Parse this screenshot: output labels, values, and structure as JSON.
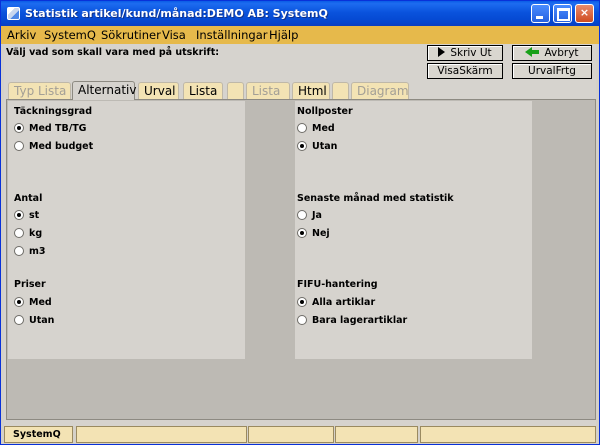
{
  "window": {
    "title": "Statistik artikel/kund/månad:DEMO AB: SystemQ",
    "minimize_label": "_",
    "maximize_label": "□",
    "close_label": "×"
  },
  "menu": {
    "items": [
      "Arkiv",
      "SystemQ",
      "Sökrutiner",
      "Visa",
      "Inställningar",
      "Hjälp"
    ]
  },
  "header": {
    "instruction": "Välj vad som skall vara med på utskrift:"
  },
  "buttons": {
    "print": "Skriv Ut",
    "cancel": "Avbryt",
    "show_screen": "VisaSkärm",
    "selection_question": "UrvalFrtg"
  },
  "tabs": [
    {
      "label": "Typ Lista",
      "state": "disabled"
    },
    {
      "label": "Alternativ",
      "state": "active"
    },
    {
      "label": "Urval",
      "state": "normal"
    },
    {
      "label": "Lista",
      "state": "normal"
    },
    {
      "label": "",
      "state": "disabled"
    },
    {
      "label": "Lista",
      "state": "disabled"
    },
    {
      "label": "Html",
      "state": "normal"
    },
    {
      "label": "",
      "state": "disabled"
    },
    {
      "label": "Diagram",
      "state": "disabled"
    }
  ],
  "groups": {
    "tackningsgrad": {
      "title": "Täckningsgrad",
      "options": [
        "Med TB/TG",
        "Med budget"
      ],
      "selected": 0
    },
    "antal": {
      "title": "Antal",
      "options": [
        "st",
        "kg",
        "m3"
      ],
      "selected": 0
    },
    "priser": {
      "title": "Priser",
      "options": [
        "Med",
        "Utan"
      ],
      "selected": 0
    },
    "nollposter": {
      "title": "Nollposter",
      "options": [
        "Med",
        "Utan"
      ],
      "selected": 1
    },
    "senaste_manad": {
      "title": "Senaste månad med statistik",
      "options": [
        "Ja",
        "Nej"
      ],
      "selected": 1
    },
    "fifu": {
      "title": "FIFU-hantering",
      "options": [
        "Alla artiklar",
        "Bara lagerartiklar"
      ],
      "selected": 0
    }
  },
  "statusbar": {
    "cells": [
      "SystemQ",
      "",
      "",
      "",
      ""
    ]
  },
  "colors": {
    "titlebar": "#0a53dd",
    "menubar": "#e6b94b",
    "tab": "#f3e3b4",
    "panel": "#d6d3ce"
  }
}
